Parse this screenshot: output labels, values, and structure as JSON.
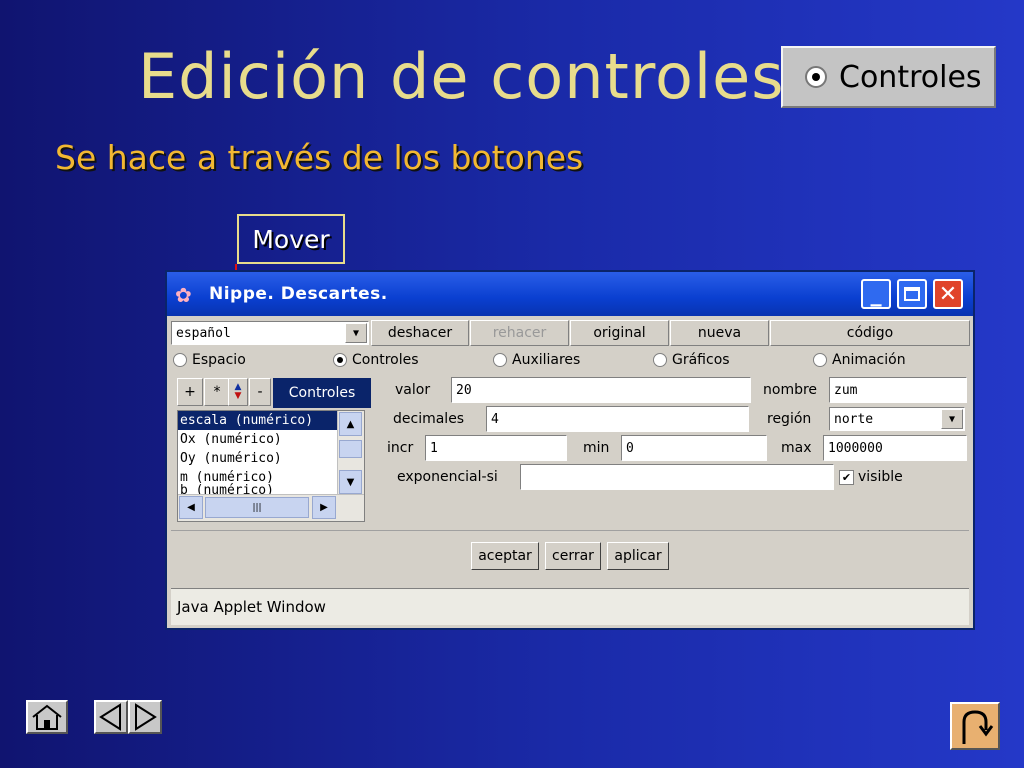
{
  "slide": {
    "title": "Edición de controles",
    "subtitle": "Se hace a través de los botones",
    "controles_image_label": "Controles",
    "callout": "Mover"
  },
  "window": {
    "title": "Nippe. Descartes.",
    "language_select": "español",
    "toolbar": [
      "deshacer",
      "rehacer",
      "original",
      "nueva",
      "código"
    ],
    "toolbar_disabled": "rehacer",
    "radios": [
      "Espacio",
      "Controles",
      "Auxiliares",
      "Gráficos",
      "Animación"
    ],
    "radio_selected": "Controles",
    "list_buttons": {
      "add": "+",
      "star": "*",
      "remove": "-"
    },
    "list_header": "Controles",
    "list_items": [
      "escala (numérico)",
      "Ox (numérico)",
      "Oy (numérico)",
      "m (numérico)",
      "b (numérico)"
    ],
    "fields": {
      "valor_label": "valor",
      "valor": "20",
      "nombre_label": "nombre",
      "nombre": "zum",
      "decimales_label": "decimales",
      "decimales": "4",
      "region_label": "región",
      "region": "norte",
      "incr_label": "incr",
      "incr": "1",
      "min_label": "min",
      "min": "0",
      "max_label": "max",
      "max": "1000000",
      "exp_label": "exponencial-si",
      "exp": "",
      "visible_label": "visible"
    },
    "buttons": {
      "accept": "aceptar",
      "close": "cerrar",
      "apply": "aplicar"
    },
    "status": "Java Applet Window"
  },
  "colors": {
    "title": "#e8dc8c",
    "subtitle": "#f2b832",
    "arrow": "#e01010"
  }
}
